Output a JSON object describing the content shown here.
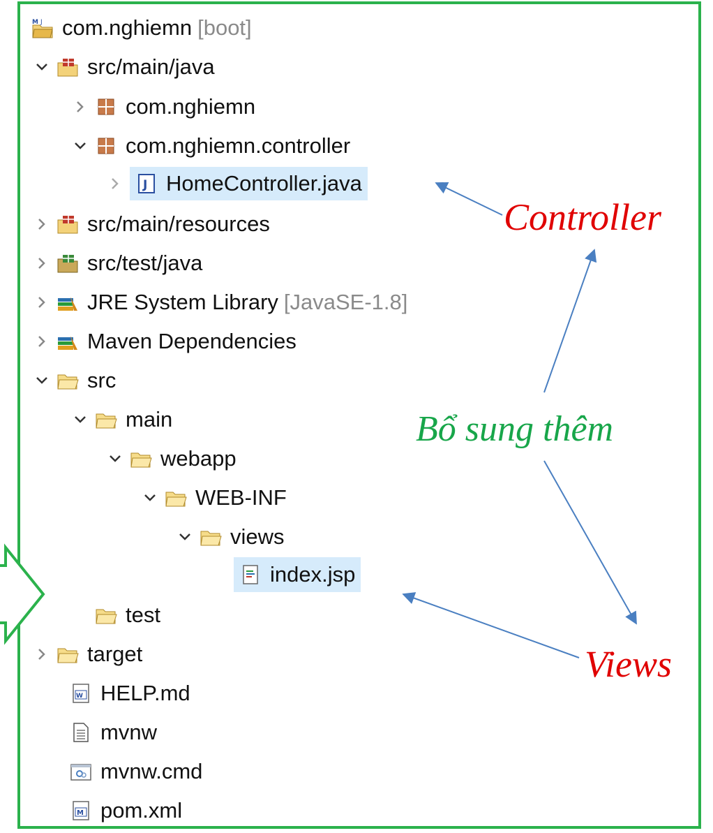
{
  "tree": {
    "project_root": {
      "label": "com.nghiemn",
      "decoration": "[boot]",
      "icon": "maven-project-icon"
    },
    "src_main_java": {
      "label": "src/main/java",
      "icon": "source-folder-icon"
    },
    "pkg_nghiemn": {
      "label": "com.nghiemn",
      "icon": "package-icon"
    },
    "pkg_controller": {
      "label": "com.nghiemn.controller",
      "icon": "package-icon"
    },
    "home_controller": {
      "label": "HomeController.java",
      "icon": "java-file-icon"
    },
    "src_main_resources": {
      "label": "src/main/resources",
      "icon": "source-folder-icon"
    },
    "src_test_java": {
      "label": "src/test/java",
      "icon": "test-source-folder-icon"
    },
    "jre_library": {
      "label": "JRE System Library",
      "decoration": "[JavaSE-1.8]",
      "icon": "library-icon"
    },
    "maven_deps": {
      "label": "Maven Dependencies",
      "icon": "library-icon"
    },
    "src": {
      "label": "src",
      "icon": "folder-icon"
    },
    "main": {
      "label": "main",
      "icon": "folder-icon"
    },
    "webapp": {
      "label": "webapp",
      "icon": "folder-icon"
    },
    "web_inf": {
      "label": "WEB-INF",
      "icon": "folder-icon"
    },
    "views": {
      "label": "views",
      "icon": "folder-icon"
    },
    "index_jsp": {
      "label": "index.jsp",
      "icon": "jsp-file-icon"
    },
    "test": {
      "label": "test",
      "icon": "folder-icon"
    },
    "target": {
      "label": "target",
      "icon": "folder-icon"
    },
    "help_md": {
      "label": "HELP.md",
      "icon": "word-file-icon"
    },
    "mvnw": {
      "label": "mvnw",
      "icon": "text-file-icon"
    },
    "mvnw_cmd": {
      "label": "mvnw.cmd",
      "icon": "cmd-file-icon"
    },
    "pom_xml": {
      "label": "pom.xml",
      "icon": "maven-pom-icon"
    }
  },
  "annotations": {
    "controller": "Controller",
    "add_more": "Bổ sung thêm",
    "views": "Views"
  },
  "colors": {
    "frame_border": "#2bb24c",
    "selection": "#d6ebfb",
    "annotation_red": "#e00000",
    "annotation_green": "#18a64a",
    "arrow": "#4a7fc1"
  }
}
